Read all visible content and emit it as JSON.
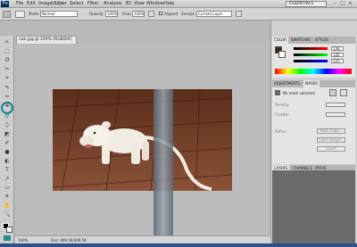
{
  "app": {
    "logo": "Ps",
    "zoom": "100%"
  },
  "menu": [
    "File",
    "Edit",
    "Image",
    "Layer",
    "Select",
    "Filter",
    "Analysis",
    "3D",
    "View",
    "Window",
    "Help"
  ],
  "workspace": "ESSENTIALS",
  "window_controls": [
    "–",
    "□",
    "×"
  ],
  "options": {
    "mode_label": "Mode:",
    "mode_value": "Normal",
    "opacity_label": "Opacity:",
    "opacity_value": "100%",
    "flow_label": "Flow:",
    "flow_value": "100%",
    "aligned_label": "Aligned",
    "sample_label": "Sample:",
    "sample_value": "Current Layer"
  },
  "document": {
    "tab_title": "cub.jpg @ 100% (RGB/8#)",
    "zoom": "100%",
    "doc_info": "Doc: 409.5K/409.5K"
  },
  "color_panel": {
    "tabs": [
      "COLOR",
      "SWATCHES",
      "STYLES"
    ],
    "values": [
      "138",
      "120",
      "125"
    ],
    "fg_color": "#3a2a1e",
    "bg_color": "#ffffff"
  },
  "masks_panel": {
    "tabs": [
      "ADJUSTMENTS",
      "MASKS"
    ],
    "status": "No mask selected",
    "density_label": "Density:",
    "feather_label": "Feather:",
    "refine_label": "Refine:",
    "buttons": [
      "Mask Edge...",
      "Color Range...",
      "Invert"
    ]
  },
  "layers_panel": {
    "tabs": [
      "LAYERS",
      "CHANNELS",
      "PATHS"
    ]
  },
  "tools": [
    "↖",
    "⬚",
    "ʘ",
    "✂",
    "⌖",
    "✎",
    "✑",
    "⎈",
    "⚲",
    "⬯",
    "◩",
    "✐",
    "●",
    "◐",
    "T",
    "↗",
    "▭",
    "⚘",
    "✋",
    "🔍",
    "■"
  ]
}
